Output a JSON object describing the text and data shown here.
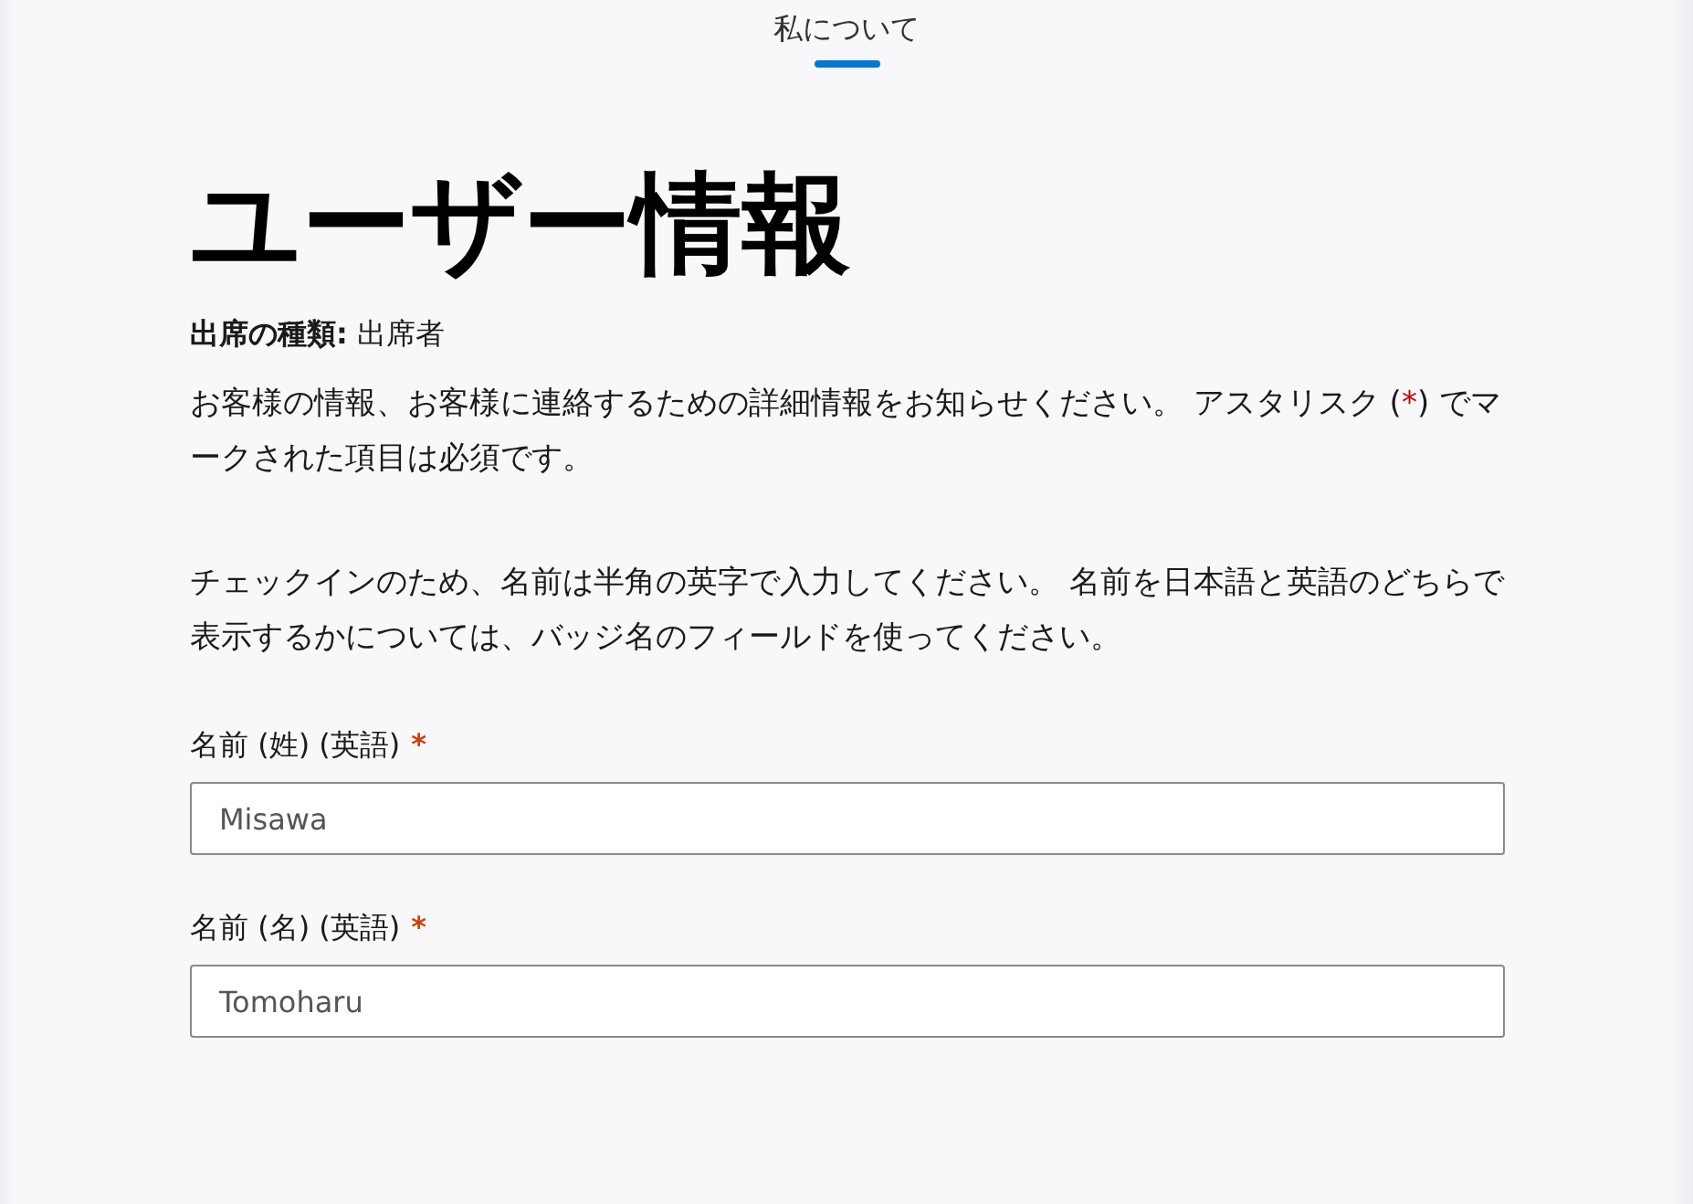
{
  "tabs": [
    {
      "label": "私について",
      "selected": true
    }
  ],
  "heading": "ユーザー情報",
  "attendance": "**出席の種類:** 出席者",
  "intro": {
    "before": "お客様の情報、お客様に連絡するための詳細情報をお知らせください。 アスタリスク (",
    "mark": "*",
    "after": ") でマークされた項目は必須です。"
  },
  "note": "チェックインのため、名前は半角の英字で入力してください。 名前を日本語と英語のどちらで表示するかについては、バッジ名のフィールドを使ってください。",
  "fields": [
    {
      "label": "名前 (姓) (英語)",
      "required_mark": "*",
      "value": "Misawa"
    },
    {
      "label": "名前 (名) (英語)",
      "required_mark": "*",
      "value": "Tomoharu"
    }
  ]
}
